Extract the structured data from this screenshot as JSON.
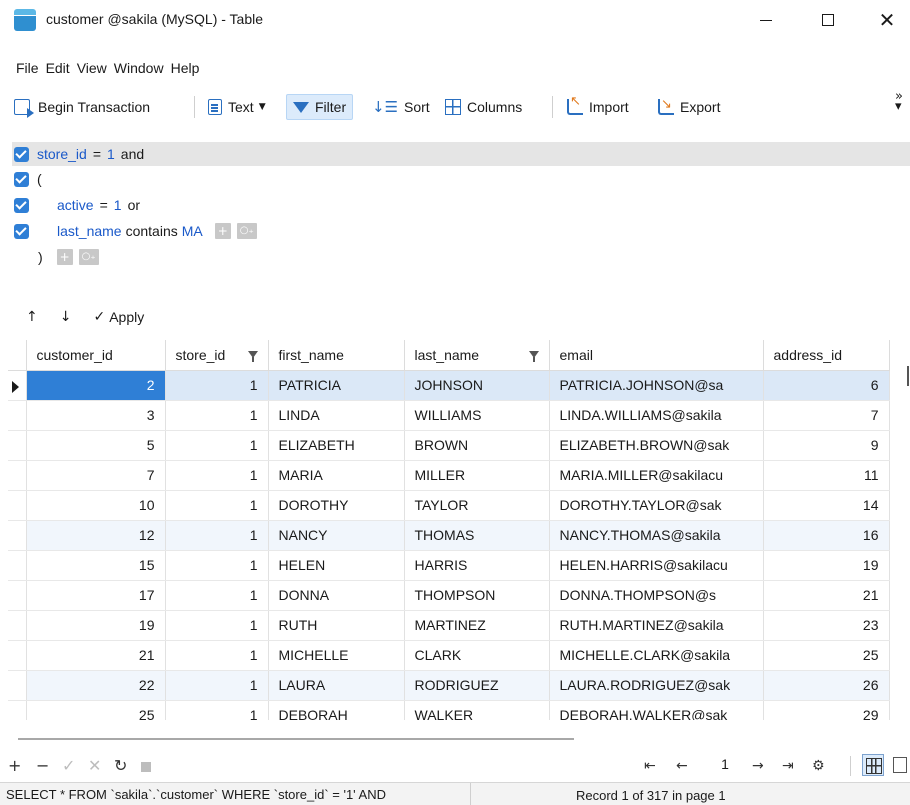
{
  "window": {
    "title": "customer @sakila (MySQL) - Table"
  },
  "menu": [
    "File",
    "Edit",
    "View",
    "Window",
    "Help"
  ],
  "toolbar": {
    "begin_transaction": "Begin Transaction",
    "text": "Text",
    "filter": "Filter",
    "sort": "Sort",
    "columns": "Columns",
    "import": "Import",
    "export": "Export"
  },
  "filter": {
    "line1": {
      "field": "store_id",
      "op": "=",
      "value": "1",
      "conj": "and"
    },
    "open_paren": "(",
    "line2": {
      "field": "active",
      "op": "=",
      "value": "1",
      "conj": "or"
    },
    "line3": {
      "field": "last_name",
      "op": "contains",
      "value": "MA"
    },
    "close_paren": ")",
    "add_label": "+",
    "group_label": "○₊",
    "apply": "Apply"
  },
  "table": {
    "columns": [
      "customer_id",
      "store_id",
      "first_name",
      "last_name",
      "email",
      "address_id"
    ],
    "rows": [
      [
        "2",
        "1",
        "PATRICIA",
        "JOHNSON",
        "PATRICIA.JOHNSON@sa",
        "6"
      ],
      [
        "3",
        "1",
        "LINDA",
        "WILLIAMS",
        "LINDA.WILLIAMS@sakila",
        "7"
      ],
      [
        "5",
        "1",
        "ELIZABETH",
        "BROWN",
        "ELIZABETH.BROWN@sak",
        "9"
      ],
      [
        "7",
        "1",
        "MARIA",
        "MILLER",
        "MARIA.MILLER@sakilacu",
        "11"
      ],
      [
        "10",
        "1",
        "DOROTHY",
        "TAYLOR",
        "DOROTHY.TAYLOR@sak",
        "14"
      ],
      [
        "12",
        "1",
        "NANCY",
        "THOMAS",
        "NANCY.THOMAS@sakila",
        "16"
      ],
      [
        "15",
        "1",
        "HELEN",
        "HARRIS",
        "HELEN.HARRIS@sakilacu",
        "19"
      ],
      [
        "17",
        "1",
        "DONNA",
        "THOMPSON",
        "DONNA.THOMPSON@s",
        "21"
      ],
      [
        "19",
        "1",
        "RUTH",
        "MARTINEZ",
        "RUTH.MARTINEZ@sakila",
        "23"
      ],
      [
        "21",
        "1",
        "MICHELLE",
        "CLARK",
        "MICHELLE.CLARK@sakila",
        "25"
      ],
      [
        "22",
        "1",
        "LAURA",
        "RODRIGUEZ",
        "LAURA.RODRIGUEZ@sak",
        "26"
      ],
      [
        "25",
        "1",
        "DEBORAH",
        "WALKER",
        "DEBORAH.WALKER@sak",
        "29"
      ]
    ]
  },
  "pager": {
    "page": "1"
  },
  "status": {
    "sql": "SELECT * FROM `sakila`.`customer` WHERE `store_id` = '1' AND",
    "record": "Record 1 of 317 in page 1"
  },
  "colors": {
    "accent": "#2f7fd6",
    "selected_row": "#dbe8f7",
    "alt_row": "#f1f6fc",
    "filter_keyword": "#1a59c9"
  }
}
